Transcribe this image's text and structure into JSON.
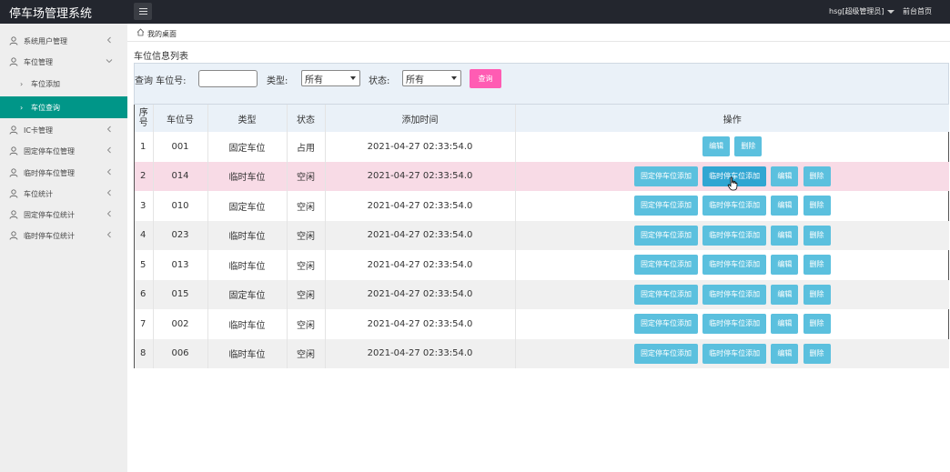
{
  "topbar": {
    "app_title": "停车场管理系统",
    "user_label": "hsg[超级管理员]",
    "front_link": "前台首页"
  },
  "sidebar": {
    "items": [
      {
        "label": "系统用户管理"
      },
      {
        "label": "车位管理"
      },
      {
        "label": "车位添加"
      },
      {
        "label": "车位查询"
      },
      {
        "label": "IC卡管理"
      },
      {
        "label": "固定停车位管理"
      },
      {
        "label": "临时停车位管理"
      },
      {
        "label": "车位统计"
      },
      {
        "label": "固定停车位统计"
      },
      {
        "label": "临时停车位统计"
      }
    ]
  },
  "breadcrumb": {
    "text": "我的桌面"
  },
  "page": {
    "heading": "车位信息列表"
  },
  "filter": {
    "query_label": "查询 车位号:",
    "type_label": "类型:",
    "type_value": "所有",
    "status_label": "状态:",
    "status_value": "所有",
    "search_button": "查询"
  },
  "table": {
    "headers": [
      "序号",
      "车位号",
      "类型",
      "状态",
      "添加时间",
      "操作"
    ],
    "rows": [
      {
        "idx": "1",
        "no": "001",
        "type": "固定车位",
        "status": "占用",
        "time": "2021-04-27 02:33:54.0"
      },
      {
        "idx": "2",
        "no": "014",
        "type": "临时车位",
        "status": "空闲",
        "time": "2021-04-27 02:33:54.0"
      },
      {
        "idx": "3",
        "no": "010",
        "type": "固定车位",
        "status": "空闲",
        "time": "2021-04-27 02:33:54.0"
      },
      {
        "idx": "4",
        "no": "023",
        "type": "临时车位",
        "status": "空闲",
        "time": "2021-04-27 02:33:54.0"
      },
      {
        "idx": "5",
        "no": "013",
        "type": "临时车位",
        "status": "空闲",
        "time": "2021-04-27 02:33:54.0"
      },
      {
        "idx": "6",
        "no": "015",
        "type": "固定车位",
        "status": "空闲",
        "time": "2021-04-27 02:33:54.0"
      },
      {
        "idx": "7",
        "no": "002",
        "type": "临时车位",
        "status": "空闲",
        "time": "2021-04-27 02:33:54.0"
      },
      {
        "idx": "8",
        "no": "006",
        "type": "临时车位",
        "status": "空闲",
        "time": "2021-04-27 02:33:54.0"
      }
    ],
    "buttons": {
      "fixed_add": "固定停车位添加",
      "temp_add": "临时停车位添加",
      "edit": "编辑",
      "delete": "删除"
    }
  },
  "colors": {
    "topbar": "#23262e",
    "active_nav": "#009688",
    "action_button": "#5bc0de",
    "search_button": "#ff5cb3",
    "hover_row": "#f8dbe6"
  }
}
